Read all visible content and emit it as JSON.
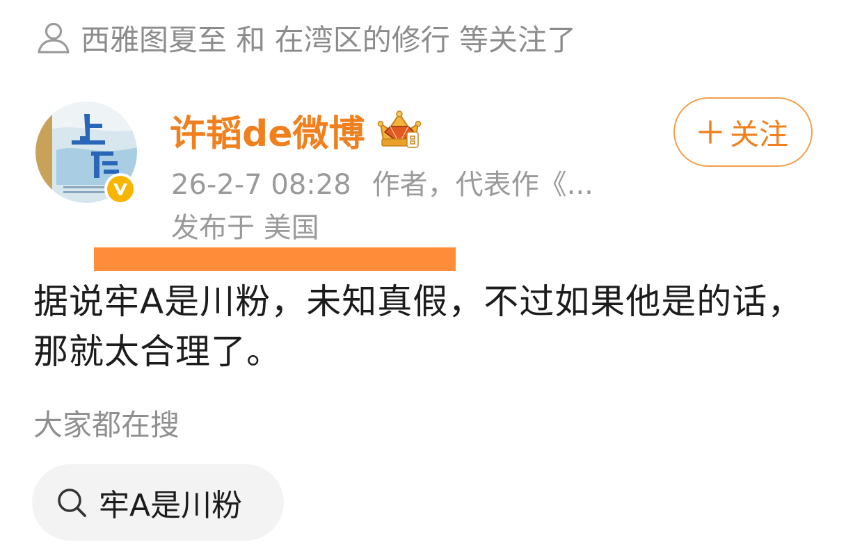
{
  "follow_hint": {
    "text": "西雅图夏至 和 在湾区的修行 等关注了",
    "icon": "user-icon"
  },
  "author": {
    "name": "许韬de微博",
    "badge_icon": "crown-icon",
    "verified_icon": "verified-v-icon",
    "avatar_icon": "avatar",
    "name_color": "#f0801d"
  },
  "post": {
    "time": "26-2-7 08:28",
    "source": "作者，代表作《...",
    "location": "发布于 美国",
    "text": "据说牢A是川粉，未知真假，不过如果他是的话，那就太合理了。"
  },
  "follow_button": {
    "label": "关注",
    "icon": "plus-icon",
    "accent": "#f3a048"
  },
  "trending": {
    "title": "大家都在搜",
    "items": [
      {
        "label": "牢A是川粉",
        "icon": "search-icon"
      }
    ]
  },
  "colors": {
    "highlight": "#ff8c38",
    "muted_text": "#9a9a9a",
    "chip_bg": "#f3f3f3"
  }
}
